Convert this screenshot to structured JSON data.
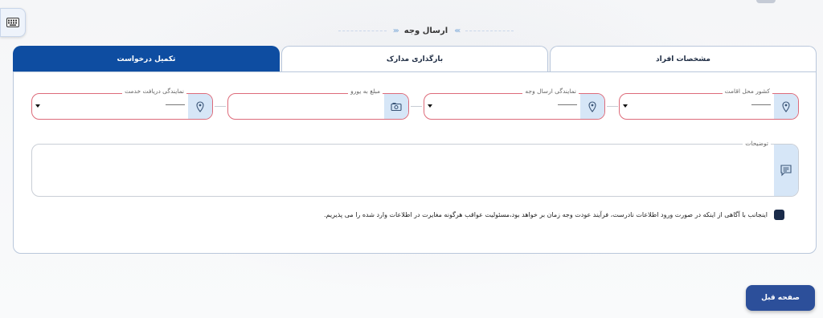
{
  "header": {
    "title": "ارسال وجه"
  },
  "tabs": [
    {
      "label": "مشخصات افراد",
      "active": false
    },
    {
      "label": "بارگذاری مدارک",
      "active": false
    },
    {
      "label": "تکمیل درخواست",
      "active": true
    }
  ],
  "form": {
    "country": {
      "label": "کشور محل اقامت",
      "value": ""
    },
    "sender_agent": {
      "label": "نمایندگی ارسال وجه",
      "value": ""
    },
    "amount_eur": {
      "label": "مبلغ به یورو",
      "value": ""
    },
    "receiver_agent": {
      "label": "نمایندگی دریافت خدمت",
      "value": ""
    },
    "description": {
      "label": "توضیحات",
      "value": ""
    },
    "agreement_text": "اینجانب با آگاهی از اینکه در صورت ورود اطلاعات نادرست، فرآیند عودت وجه زمان بر خواهد بود،مسئولیت عواقب هرگونه مغایرت در اطلاعات وارد شده را می پذیریم."
  },
  "footer": {
    "previous_button_label": "صفحه قبل"
  },
  "icons": {
    "keyboard": "keyboard-icon",
    "location": "map-pin-icon",
    "money": "cash-icon",
    "description": "message-icon"
  },
  "colors": {
    "primary": "#0e4da1",
    "button": "#2c4f9a",
    "field_error_border": "#dd6b7a",
    "icon_bg": "#d6e6f7"
  }
}
